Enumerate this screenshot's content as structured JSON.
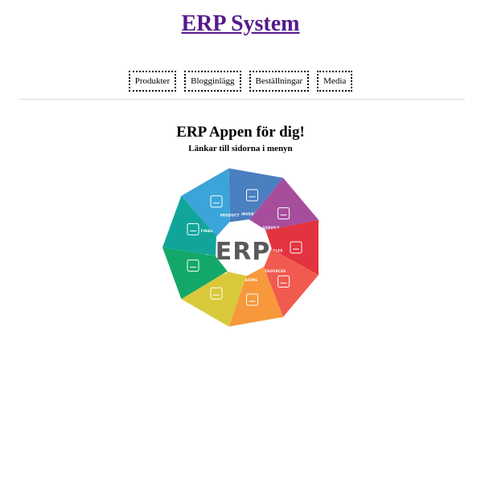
{
  "header": {
    "title": "ERP System"
  },
  "nav": {
    "items": [
      {
        "label": "Produkter"
      },
      {
        "label": "Blogginlägg"
      },
      {
        "label": "Beställningar"
      },
      {
        "label": "Media"
      }
    ]
  },
  "main": {
    "heading": "ERP Appen för dig!",
    "subheading": "Länkar till sidorna i menyn",
    "graphic": {
      "center_text": "ERP",
      "segments": [
        {
          "label": "INVENTORY",
          "color": "#4a7fc0",
          "icon": "boxes-icon"
        },
        {
          "label": "SERVICE",
          "color": "#a64d9c",
          "icon": "gears-icon"
        },
        {
          "label": "SALES",
          "color": "#e2333f",
          "icon": "cash-register-icon"
        },
        {
          "label": "HUMAN RESOURCES",
          "color": "#f05a4f",
          "icon": "presenter-icon"
        },
        {
          "label": "PURCHASING",
          "color": "#f7983c",
          "icon": "clipboard-icon"
        },
        {
          "label": "CRM",
          "color": "#d9c93a",
          "icon": "person-gear-icon"
        },
        {
          "label": "MRP",
          "color": "#13a86a",
          "icon": "factory-icon"
        },
        {
          "label": "FINANCIALS",
          "color": "#11a59a",
          "icon": "finance-chart-icon"
        },
        {
          "label": "PRODUCT",
          "color": "#3ba4d8",
          "icon": "product-box-icon"
        }
      ]
    }
  }
}
